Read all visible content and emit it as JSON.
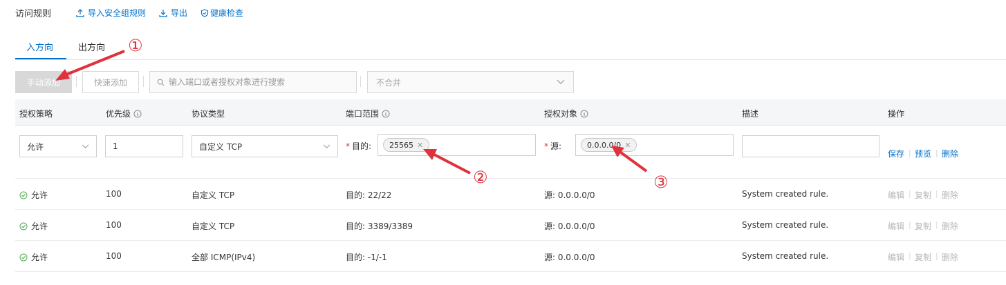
{
  "header": {
    "title": "访问规则",
    "links": [
      {
        "label": "导入安全组规则",
        "icon": "upload-icon"
      },
      {
        "label": "导出",
        "icon": "download-icon"
      },
      {
        "label": "健康检查",
        "icon": "shield-check-icon"
      }
    ]
  },
  "tabs": [
    {
      "label": "入方向",
      "active": true
    },
    {
      "label": "出方向",
      "active": false
    }
  ],
  "toolbar": {
    "manual_add": "手动添加",
    "quick_add": "快速添加",
    "search_placeholder": "输入端口或者授权对象进行搜索",
    "merge_select": "不合并"
  },
  "table": {
    "columns": [
      "授权策略",
      "优先级",
      "协议类型",
      "端口范围",
      "授权对象",
      "描述",
      "操作"
    ],
    "edit_row": {
      "policy": "允许",
      "priority": "1",
      "protocol": "自定义 TCP",
      "port_label": "目的:",
      "port_tag": "25565",
      "object_label": "源:",
      "object_tag": "0.0.0.0/0",
      "description": "",
      "actions": [
        "保存",
        "预览",
        "删除"
      ]
    },
    "rows": [
      {
        "policy": "允许",
        "priority": "100",
        "protocol": "自定义 TCP",
        "port": "目的: 22/22",
        "object": "源: 0.0.0.0/0",
        "description": "System created rule.",
        "actions": [
          "编辑",
          "复制",
          "删除"
        ]
      },
      {
        "policy": "允许",
        "priority": "100",
        "protocol": "自定义 TCP",
        "port": "目的: 3389/3389",
        "object": "源: 0.0.0.0/0",
        "description": "System created rule.",
        "actions": [
          "编辑",
          "复制",
          "删除"
        ]
      },
      {
        "policy": "允许",
        "priority": "100",
        "protocol": "全部 ICMP(IPv4)",
        "port": "目的: -1/-1",
        "object": "源: 0.0.0.0/0",
        "description": "System created rule.",
        "actions": [
          "编辑",
          "复制",
          "删除"
        ]
      }
    ]
  },
  "annotations": [
    "①",
    "②",
    "③"
  ],
  "colors": {
    "accent": "#0070cc",
    "annotation": "#e0323c",
    "allow": "#52a954"
  }
}
